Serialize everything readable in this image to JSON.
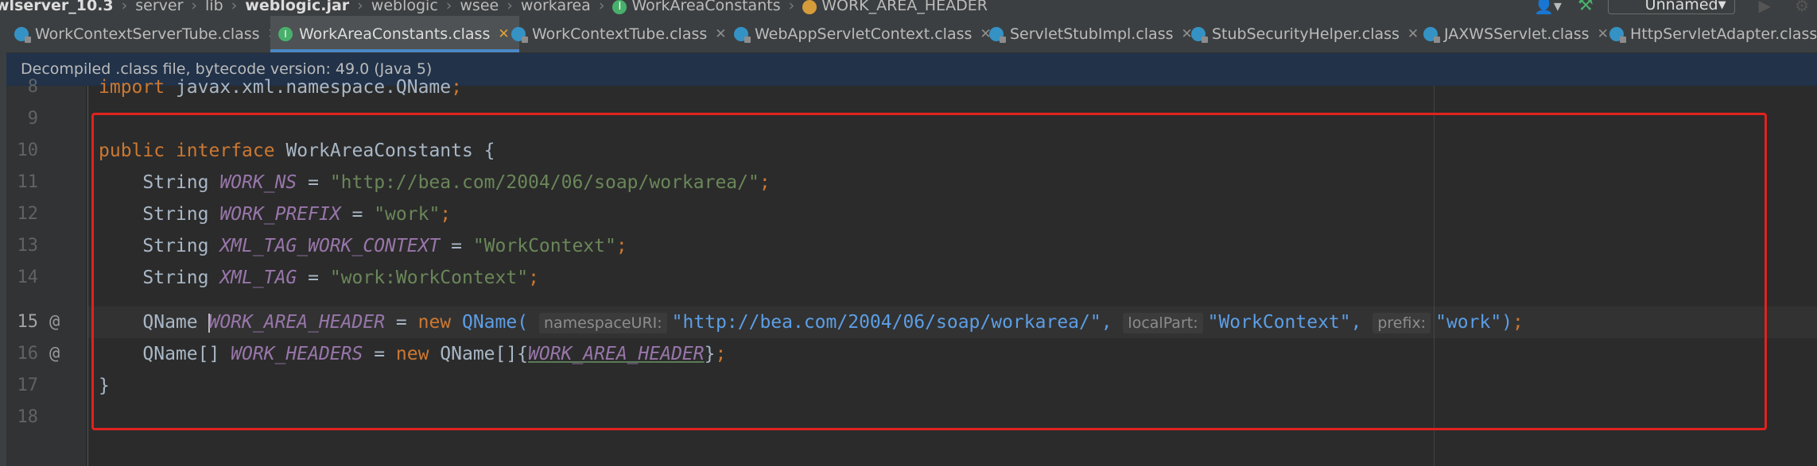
{
  "breadcrumb": {
    "items": [
      "wlserver_10.3",
      "server",
      "lib",
      "weblogic.jar",
      "weblogic",
      "wsee",
      "workarea",
      "WorkAreaConstants",
      "WORK_AREA_HEADER"
    ]
  },
  "toolbar": {
    "run_config": "Unnamed"
  },
  "tabs": [
    {
      "label": "WorkContextServerTube.class",
      "active": false
    },
    {
      "label": "WorkAreaConstants.class",
      "active": true
    },
    {
      "label": "WorkContextTube.class",
      "active": false
    },
    {
      "label": "WebAppServletContext.class",
      "active": false
    },
    {
      "label": "ServletStubImpl.class",
      "active": false
    },
    {
      "label": "StubSecurityHelper.class",
      "active": false
    },
    {
      "label": "JAXWSServlet.class",
      "active": false
    },
    {
      "label": "HttpServletAdapter.class",
      "active": false
    }
  ],
  "notice": "Decompiled .class file, bytecode version: 49.0 (Java 5)",
  "editor": {
    "line_numbers": [
      "8",
      "9",
      "10",
      "11",
      "12",
      "13",
      "14",
      "15",
      "16",
      "17",
      "18"
    ],
    "current_line": "15",
    "gutter_marks": {
      "15": "@",
      "16": "@"
    },
    "code": {
      "l8_kw": "import",
      "l8_rest": " javax.xml.namespace.QName",
      "l8_semi": ";",
      "l10_kw1": "public",
      "l10_kw2": "interface",
      "l10_name": "WorkAreaConstants {",
      "l11_type": "String ",
      "l11_field": "WORK_NS",
      "l11_eq": " = ",
      "l11_str": "\"http://bea.com/2004/06/soap/workarea/\"",
      "l11_semi": ";",
      "l12_type": "String ",
      "l12_field": "WORK_PREFIX",
      "l12_eq": " = ",
      "l12_str": "\"work\"",
      "l12_semi": ";",
      "l13_type": "String ",
      "l13_field": "XML_TAG_WORK_CONTEXT",
      "l13_eq": " = ",
      "l13_str": "\"WorkContext\"",
      "l13_semi": ";",
      "l14_type": "String ",
      "l14_field": "XML_TAG",
      "l14_eq": " = ",
      "l14_str": "\"work:WorkContext\"",
      "l14_semi": ";",
      "l15_type": "QName ",
      "l15_field": "WORK_AREA_HEADER",
      "l15_eq": " = ",
      "l15_new": "new",
      "l15_ctor": " QName(",
      "l15_hint1": "namespaceURI:",
      "l15_str1": "\"http://bea.com/2004/06/soap/workarea/\"",
      "l15_comma1": ", ",
      "l15_hint2": "localPart:",
      "l15_str2": "\"WorkContext\"",
      "l15_comma2": ", ",
      "l15_hint3": "prefix:",
      "l15_str3": "\"work\"",
      "l15_close": ")",
      "l15_semi": ";",
      "l16_type": "QName[] ",
      "l16_field": "WORK_HEADERS",
      "l16_eq": " = ",
      "l16_new": "new",
      "l16_ctor": " QName[]{",
      "l16_ref": "WORK_AREA_HEADER",
      "l16_close": "}",
      "l16_semi": ";",
      "l17_brace": "}"
    }
  },
  "colors": {
    "keyword": "#cc7832",
    "field": "#9876aa",
    "string": "#6a8759",
    "highlight_box": "#e0221e",
    "active_tab_underline": "#4a88c7",
    "notice_bg": "#213249"
  }
}
